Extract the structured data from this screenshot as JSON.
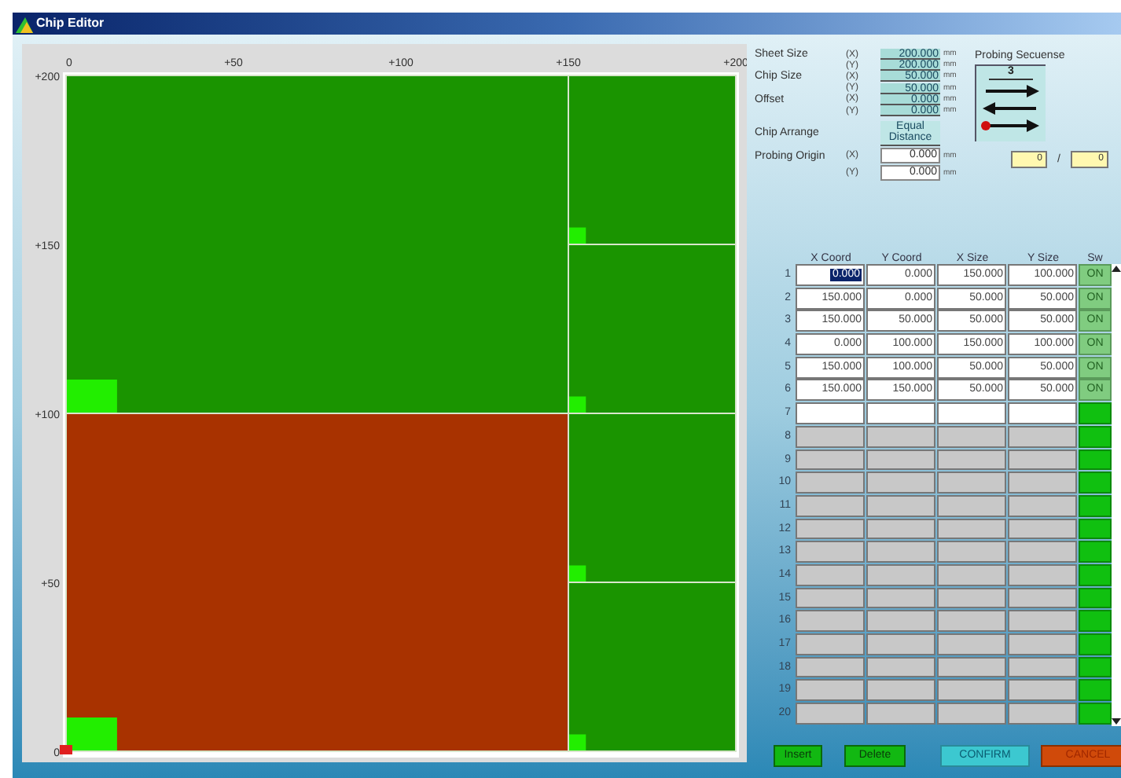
{
  "window": {
    "title": "Chip Editor"
  },
  "layout_view": {
    "x_ticks": [
      "0",
      "+50",
      "+100",
      "+150",
      "+200"
    ],
    "y_ticks": [
      "+200",
      "+150",
      "+100",
      "+50",
      "0"
    ]
  },
  "settings": [
    {
      "kind": "display",
      "label": "Sheet Size",
      "rows": [
        {
          "axis": "(X)",
          "value": "200.000",
          "unit": "mm"
        },
        {
          "axis": "(Y)",
          "value": "200.000",
          "unit": "mm"
        }
      ]
    },
    {
      "kind": "display",
      "label": "Chip Size",
      "rows": [
        {
          "axis": "(X)",
          "value": "50.000",
          "unit": "mm"
        },
        {
          "axis": "(Y)",
          "value": "50.000",
          "unit": "mm"
        }
      ]
    },
    {
      "kind": "display",
      "label": "Offset",
      "rows": [
        {
          "axis": "(X)",
          "value": "0.000",
          "unit": "mm"
        },
        {
          "axis": "(Y)",
          "value": "0.000",
          "unit": "mm"
        }
      ]
    },
    {
      "kind": "choice",
      "label": "Chip Arrange",
      "value": "Equal Distance"
    },
    {
      "kind": "input",
      "label": "Probing Origin",
      "rows": [
        {
          "axis": "(X)",
          "value": "0.000",
          "unit": "mm"
        },
        {
          "axis": "(Y)",
          "value": "0.000",
          "unit": "mm"
        }
      ]
    }
  ],
  "probing": {
    "title": "Probing Secuense",
    "pattern": "3"
  },
  "counter": {
    "current": "0",
    "separator": "/",
    "total": "0"
  },
  "table": {
    "columns": [
      "X Coord",
      "Y Coord",
      "X Size",
      "Y Size",
      "Sw"
    ],
    "rows": [
      {
        "no": "1",
        "x_coord": "0.000",
        "y_coord": "0.000",
        "x_size": "150.000",
        "y_size": "100.000",
        "sw": "ON",
        "selected": true,
        "active": true,
        "disabled": false
      },
      {
        "no": "2",
        "x_coord": "150.000",
        "y_coord": "0.000",
        "x_size": "50.000",
        "y_size": "50.000",
        "sw": "ON",
        "selected": false,
        "active": true,
        "disabled": false
      },
      {
        "no": "3",
        "x_coord": "150.000",
        "y_coord": "50.000",
        "x_size": "50.000",
        "y_size": "50.000",
        "sw": "ON",
        "selected": false,
        "active": true,
        "disabled": false
      },
      {
        "no": "4",
        "x_coord": "0.000",
        "y_coord": "100.000",
        "x_size": "150.000",
        "y_size": "100.000",
        "sw": "ON",
        "selected": false,
        "active": true,
        "disabled": false
      },
      {
        "no": "5",
        "x_coord": "150.000",
        "y_coord": "100.000",
        "x_size": "50.000",
        "y_size": "50.000",
        "sw": "ON",
        "selected": false,
        "active": true,
        "disabled": false
      },
      {
        "no": "6",
        "x_coord": "150.000",
        "y_coord": "150.000",
        "x_size": "50.000",
        "y_size": "50.000",
        "sw": "ON",
        "selected": false,
        "active": true,
        "disabled": false
      },
      {
        "no": "7",
        "active": false,
        "disabled": false
      },
      {
        "no": "8",
        "active": false,
        "disabled": true
      },
      {
        "no": "9",
        "active": false,
        "disabled": true
      },
      {
        "no": "10",
        "active": false,
        "disabled": true
      },
      {
        "no": "11",
        "active": false,
        "disabled": true
      },
      {
        "no": "12",
        "active": false,
        "disabled": true
      },
      {
        "no": "13",
        "active": false,
        "disabled": true
      },
      {
        "no": "14",
        "active": false,
        "disabled": true
      },
      {
        "no": "15",
        "active": false,
        "disabled": true
      },
      {
        "no": "16",
        "active": false,
        "disabled": true
      },
      {
        "no": "17",
        "active": false,
        "disabled": true
      },
      {
        "no": "18",
        "active": false,
        "disabled": true
      },
      {
        "no": "19",
        "active": false,
        "disabled": true
      },
      {
        "no": "20",
        "active": false,
        "disabled": true
      }
    ]
  },
  "buttons": [
    {
      "label": "Insert",
      "kind": "edit"
    },
    {
      "label": "Delete",
      "kind": "edit"
    },
    {
      "label": "CONFIRM",
      "kind": "confirm"
    },
    {
      "label": "CANCEL",
      "kind": "cancel"
    }
  ]
}
